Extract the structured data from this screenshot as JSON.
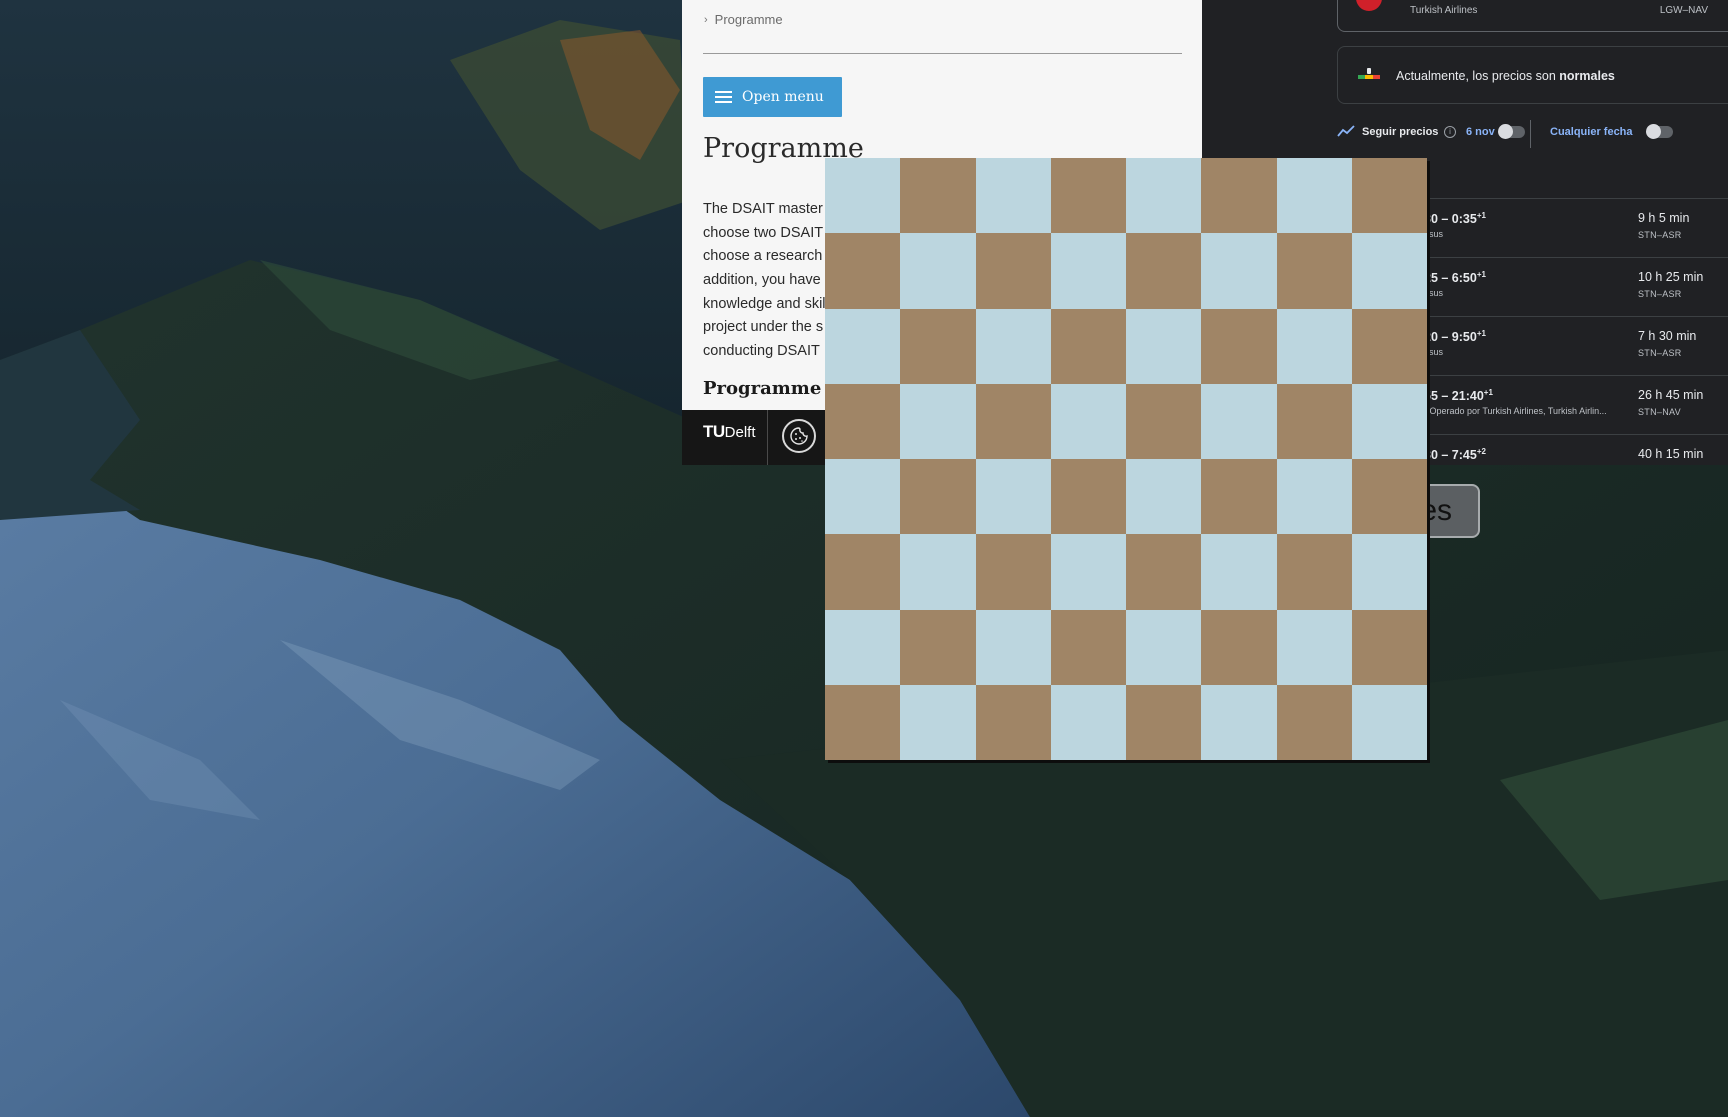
{
  "tudelft_window": {
    "breadcrumb": "Programme",
    "open_menu_label": "Open menu",
    "title": "Programme",
    "body_lines": [
      "The DSAIT master",
      "choose two DSAIT",
      "choose a research",
      "addition, you have",
      "knowledge and skil",
      "project under the s",
      "conducting DSAIT"
    ],
    "subtitle": "Programme",
    "footer": {
      "logo_prefix": "TU",
      "logo_suffix": "Delft",
      "cookie_icon": "cookie-icon"
    }
  },
  "flights_window": {
    "top_card": {
      "airline": "Turkish Airlines",
      "route": "LGW–NAV"
    },
    "price_notice": {
      "prefix": "Actualmente, los precios son ",
      "emphasis": "normales"
    },
    "track_prices": {
      "label": "Seguir precios",
      "date": "6 nov",
      "any_date_label": "Cualquier fecha"
    },
    "flights": [
      {
        "time": "30 – 0:35",
        "sup": "+1",
        "sub": "asus",
        "duration": "9 h 5 min",
        "route": "STN–ASR"
      },
      {
        "time": "25 – 6:50",
        "sup": "+1",
        "sub": "asus",
        "duration": "10 h 25 min",
        "route": "STN–ASR"
      },
      {
        "time": "20 – 9:50",
        "sup": "+1",
        "sub": "asus",
        "duration": "7 h 30 min",
        "route": "STN–ASR"
      },
      {
        "time": "55 – 21:40",
        "sup": "+1",
        "sub": "· Operado por Turkish Airlines, Turkish Airlin...",
        "duration": "26 h 45 min",
        "route": "STN–NAV"
      },
      {
        "time": "30 – 7:45",
        "sup": "+2",
        "sub": "",
        "duration": "40 h 15 min",
        "route": ""
      }
    ]
  },
  "partial_button_label": "es",
  "checkerboard": {
    "rows": 8,
    "cols": 8,
    "light_color": "#bcd6df",
    "dark_color": "#a08566",
    "top_left": "light"
  }
}
